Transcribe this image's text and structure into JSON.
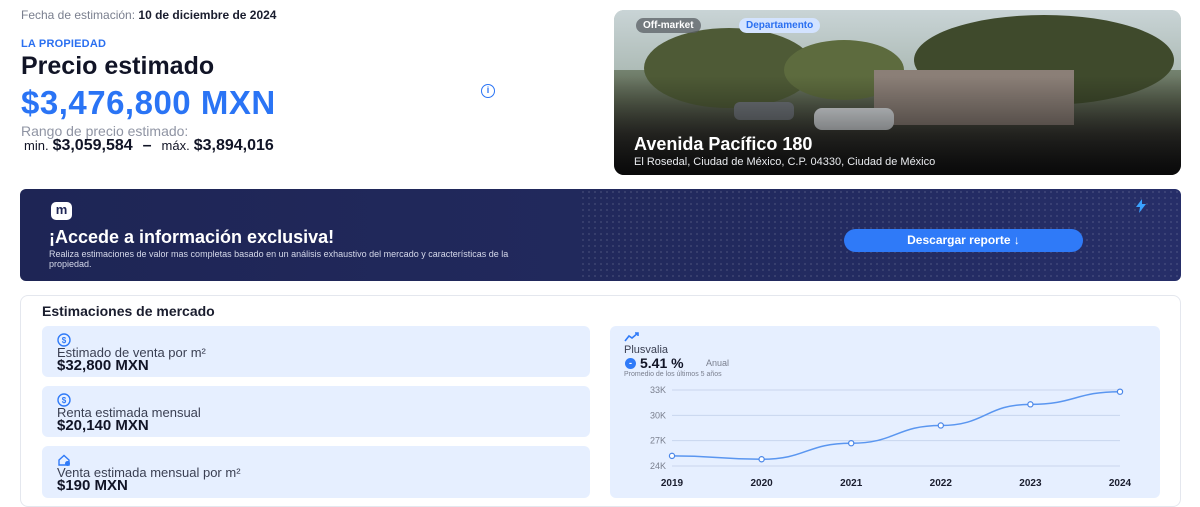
{
  "estimate": {
    "date_label": "Fecha de estimación:",
    "date_value": "10 de diciembre de 2024",
    "section_label": "LA PROPIEDAD",
    "price_title": "Precio estimado",
    "price_value": "$3,476,800 MXN",
    "info_icon": "info-icon",
    "range_label": "Rango de precio estimado:",
    "min_label": "min.",
    "min_value": "$3,059,584",
    "separator": "–",
    "max_label": "máx.",
    "max_value": "$3,894,016"
  },
  "property": {
    "badge_status": "Off-market",
    "badge_type": "Departamento",
    "address": "Avenida Pacífico 180",
    "location": "El Rosedal, Ciudad de México, C.P. 04330, Ciudad de México"
  },
  "promo": {
    "logo_letter": "m",
    "title": "¡Accede a información exclusiva!",
    "description": "Realiza estimaciones de valor mas completas basado en un análisis exhaustivo del mercado y características de la propiedad.",
    "button_label": "Descargar reporte ↓"
  },
  "market": {
    "title": "Estimaciones de mercado",
    "cards": [
      {
        "icon": "dollar-circle-icon",
        "label": "Estimado de venta por m²",
        "value": "$32,800 MXN"
      },
      {
        "icon": "dollar-circle-icon",
        "label": "Renta estimada mensual",
        "value": "$20,140 MXN"
      },
      {
        "icon": "home-dollar-icon",
        "label": "Venta estimada mensual por m²",
        "value": "$190 MXN"
      }
    ],
    "plusvalia": {
      "icon": "trend-up-icon",
      "label": "Plusvalia",
      "value": "5.41 %",
      "unit": "Anual",
      "note": "Promedio de los últimos 5 años"
    }
  },
  "colors": {
    "accent": "#2a74f5",
    "promo_bg": "#1e2555",
    "card_bg": "#e6efff"
  },
  "chart_data": {
    "type": "line",
    "x": [
      "2019",
      "2020",
      "2021",
      "2022",
      "2023",
      "2024"
    ],
    "series": [
      {
        "values": [
          25200,
          24800,
          26700,
          28800,
          31300,
          32800
        ]
      }
    ],
    "yticks": [
      "24K",
      "27K",
      "30K",
      "33K"
    ],
    "ytick_values": [
      24000,
      27000,
      30000,
      33000
    ],
    "ylim": [
      24000,
      33000
    ],
    "grid": true
  }
}
